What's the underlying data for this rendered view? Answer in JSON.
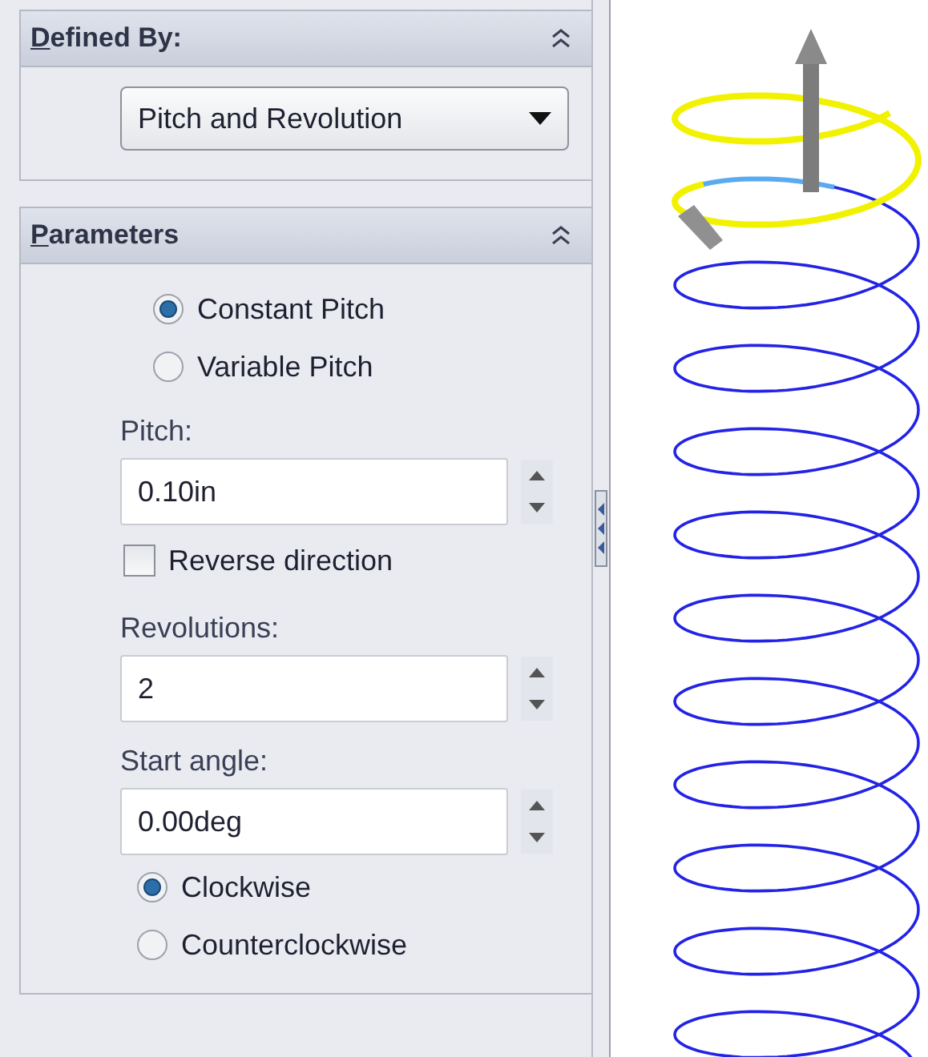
{
  "sections": [
    {
      "title": "Defined By:",
      "expanded": true,
      "items": [
        {
          "kind": "dropdown",
          "value": "Pitch and Revolution"
        }
      ]
    },
    {
      "title": "Parameters",
      "expanded": true,
      "items": [
        {
          "kind": "radio",
          "label": "Constant Pitch",
          "selected": true
        },
        {
          "kind": "radio",
          "label": "Variable Pitch",
          "selected": false
        },
        {
          "kind": "spin",
          "label": "Pitch:",
          "value": "0.10in"
        },
        {
          "kind": "checkbox",
          "label": "Reverse direction",
          "checked": false
        },
        {
          "kind": "spin",
          "label": "Revolutions:",
          "value": "2"
        },
        {
          "kind": "spin",
          "label": "Start angle:",
          "value": "0.00deg"
        },
        {
          "kind": "radio",
          "label": "Clockwise",
          "selected": true
        },
        {
          "kind": "radio",
          "label": "Counterclockwise",
          "selected": false
        }
      ]
    }
  ]
}
